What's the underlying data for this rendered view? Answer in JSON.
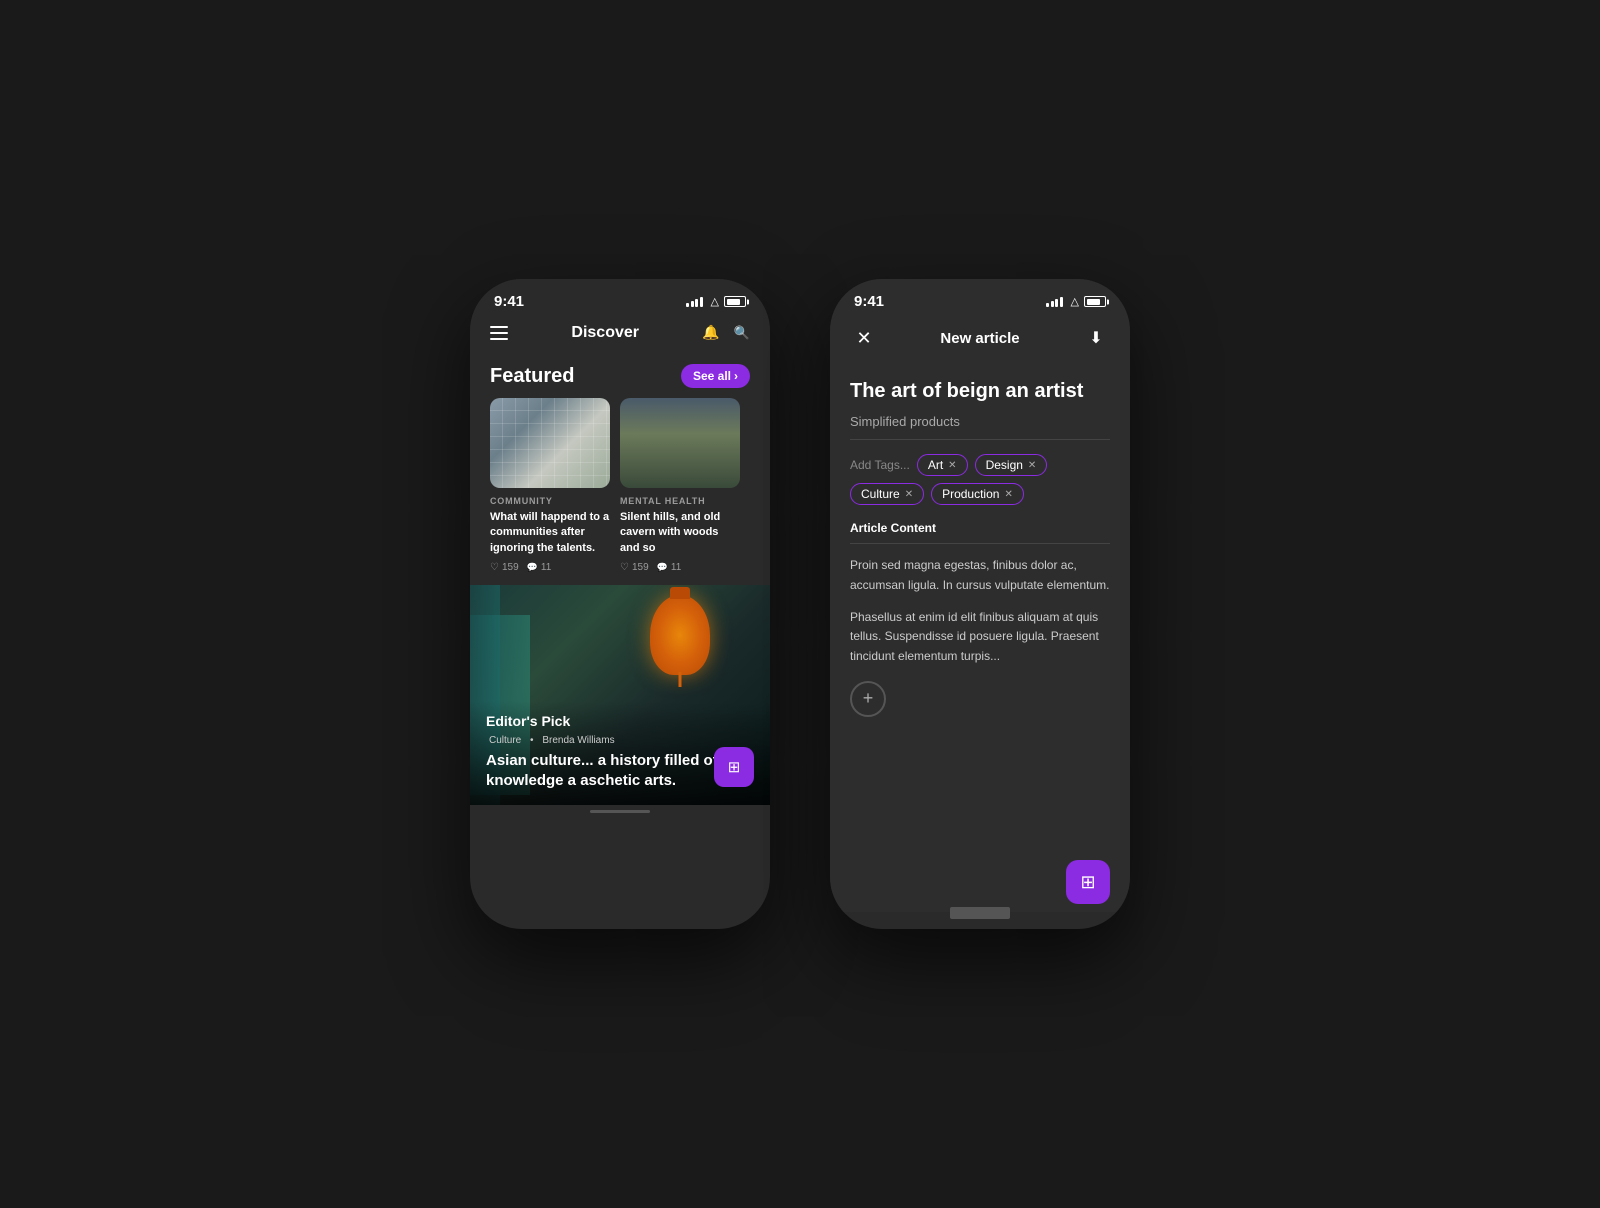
{
  "phone1": {
    "statusBar": {
      "time": "9:41"
    },
    "navBar": {
      "title": "Discover"
    },
    "featured": {
      "title": "Featured",
      "seeAllBtn": "See all",
      "cards": [
        {
          "category": "COMMUNITY",
          "text": "What will happend to a communities after ignoring the talents.",
          "likes": "159",
          "comments": "11"
        },
        {
          "category": "MENTAL HEALTH",
          "text": "Silent hills, and old cavern with woods and so",
          "likes": "159",
          "comments": "11"
        }
      ]
    },
    "editorsPick": {
      "label": "Editor's Pick",
      "category": "Culture",
      "author": "Brenda Williams",
      "articleTitle": "Asian culture... a history filled of knowledge a aschetic arts."
    }
  },
  "phone2": {
    "statusBar": {
      "time": "9:41"
    },
    "navBar": {
      "title": "New article"
    },
    "article": {
      "title": "The art of beign an artist",
      "subtitle": "Simplified products",
      "tagsLabel": "Add Tags...",
      "tags": [
        {
          "label": "Art"
        },
        {
          "label": "Design"
        },
        {
          "label": "Culture"
        },
        {
          "label": "Production"
        }
      ],
      "contentLabel": "Article Content",
      "paragraphs": [
        "Proin sed magna egestas, finibus dolor ac, accumsan ligula. In cursus vulputate elementum.",
        "Phasellus at enim id elit finibus aliquam at quis tellus. Suspendisse id posuere ligula. Praesent tincidunt elementum turpis..."
      ],
      "addBtnLabel": "+"
    },
    "fabIcon": "⊞"
  },
  "colors": {
    "accent": "#8b2be2",
    "bg1": "#2a2a2a",
    "bg2": "#2d2d2d",
    "text": "#ffffff",
    "muted": "#aaaaaa"
  }
}
